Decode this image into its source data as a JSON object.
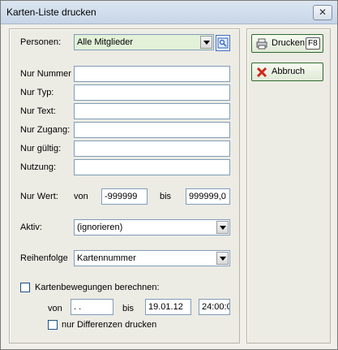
{
  "window": {
    "title": "Karten-Liste drucken",
    "close_glyph": "✕"
  },
  "form": {
    "personen_label": "Personen:",
    "personen_value": "Alle Mitglieder",
    "nur_nummer_label": "Nur Nummer",
    "nur_typ_label": "Nur Typ:",
    "nur_text_label": "Nur Text:",
    "nur_zugang_label": "Nur Zugang:",
    "nur_gueltig_label": "Nur gültig:",
    "nutzung_label": "Nutzung:",
    "nur_wert_label": "Nur Wert:",
    "von_label": "von",
    "wert_von": "-999999",
    "bis_label": "bis",
    "wert_bis": "999999,0",
    "aktiv_label": "Aktiv:",
    "aktiv_value": "(ignorieren)",
    "reihenfolge_label": "Reihenfolge",
    "reihenfolge_value": "Kartennummer",
    "bewegungen_label": "Kartenbewegungen berechnen:",
    "bewegungen_checked": false,
    "bew_von_label": "von",
    "bew_von_value": " .  .",
    "bew_bis_label": "bis",
    "bew_bis_date": "19.01.12",
    "bew_bis_time": "24:00:0",
    "differenzen_label": "nur Differenzen drucken",
    "differenzen_checked": false
  },
  "buttons": {
    "drucken_label": "Drucken",
    "drucken_key": "F8",
    "abbruch_label": "Abbruch",
    "drucken_icon": "printer-icon",
    "abbruch_icon": "red-x-icon"
  },
  "colors": {
    "combo_highlight": "#e3f1d9",
    "cancel_x": "#d0271d"
  }
}
